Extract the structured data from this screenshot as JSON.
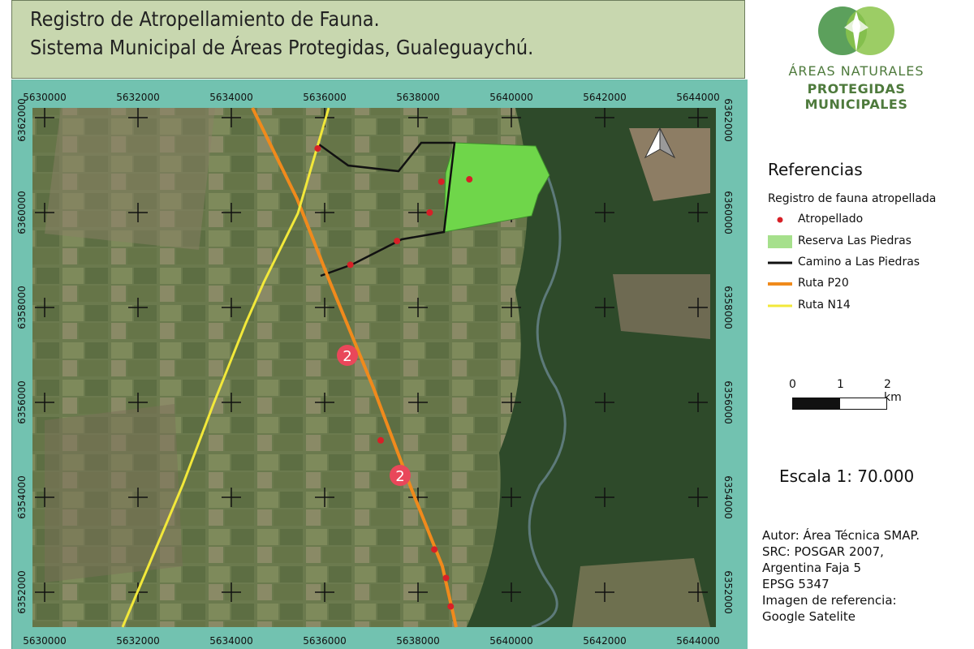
{
  "title": {
    "line1": "Registro de Atropellamiento de Fauna.",
    "line2": "Sistema Municipal de Áreas Protegidas, Gualeguaychú."
  },
  "map": {
    "x_ticks": [
      "5630000",
      "5632000",
      "5634000",
      "5636000",
      "5638000",
      "5640000",
      "5642000",
      "5644000"
    ],
    "y_ticks": [
      "6362000",
      "6360000",
      "6358000",
      "6356000",
      "6354000",
      "6352000"
    ],
    "route_shield_label": "2",
    "north_arrow_icon": "north-arrow-icon",
    "colors": {
      "frame": "#72c2b0",
      "reserve": "#6fd64a",
      "camino": "#111111",
      "ruta_p20": "#f08a1c",
      "ruta_n14": "#f2e83a",
      "atropellado": "#d72027",
      "shield": "#e9475a"
    },
    "atropellados": [
      {
        "x": 5635850,
        "y": 6361350
      },
      {
        "x": 5638500,
        "y": 6360650
      },
      {
        "x": 5639100,
        "y": 6360700
      },
      {
        "x": 5638250,
        "y": 6360000
      },
      {
        "x": 5637550,
        "y": 6359400
      },
      {
        "x": 5636550,
        "y": 6358900
      },
      {
        "x": 5637200,
        "y": 6355200
      },
      {
        "x": 5638350,
        "y": 6352900
      },
      {
        "x": 5638600,
        "y": 6352300
      },
      {
        "x": 5638700,
        "y": 6351700
      }
    ]
  },
  "logo": {
    "line1": "ÁREAS NATURALES",
    "line2": "PROTEGIDAS MUNICIPALES"
  },
  "legend": {
    "title": "Referencias",
    "subtitle": "Registro de fauna atropellada",
    "items": [
      {
        "label": "Atropellado",
        "kind": "point",
        "color": "#d72027"
      },
      {
        "label": "Reserva Las Piedras",
        "kind": "fill",
        "color": "#a6e08c"
      },
      {
        "label": "Camino a Las Piedras",
        "kind": "line",
        "color": "#111111"
      },
      {
        "label": "Ruta P20",
        "kind": "line",
        "color": "#f08a1c"
      },
      {
        "label": "Ruta N14",
        "kind": "line",
        "color": "#f2e83a"
      }
    ]
  },
  "scalebar": {
    "labels": [
      "0",
      "1",
      "2 km"
    ]
  },
  "scale": {
    "text": "Escala 1: 70.000"
  },
  "credits": {
    "lines": [
      "Autor: Área Técnica SMAP.",
      "SRC: POSGAR 2007,",
      "Argentina Faja 5",
      "EPSG 5347",
      "Imagen de referencia:",
      "Google Satelite"
    ]
  }
}
